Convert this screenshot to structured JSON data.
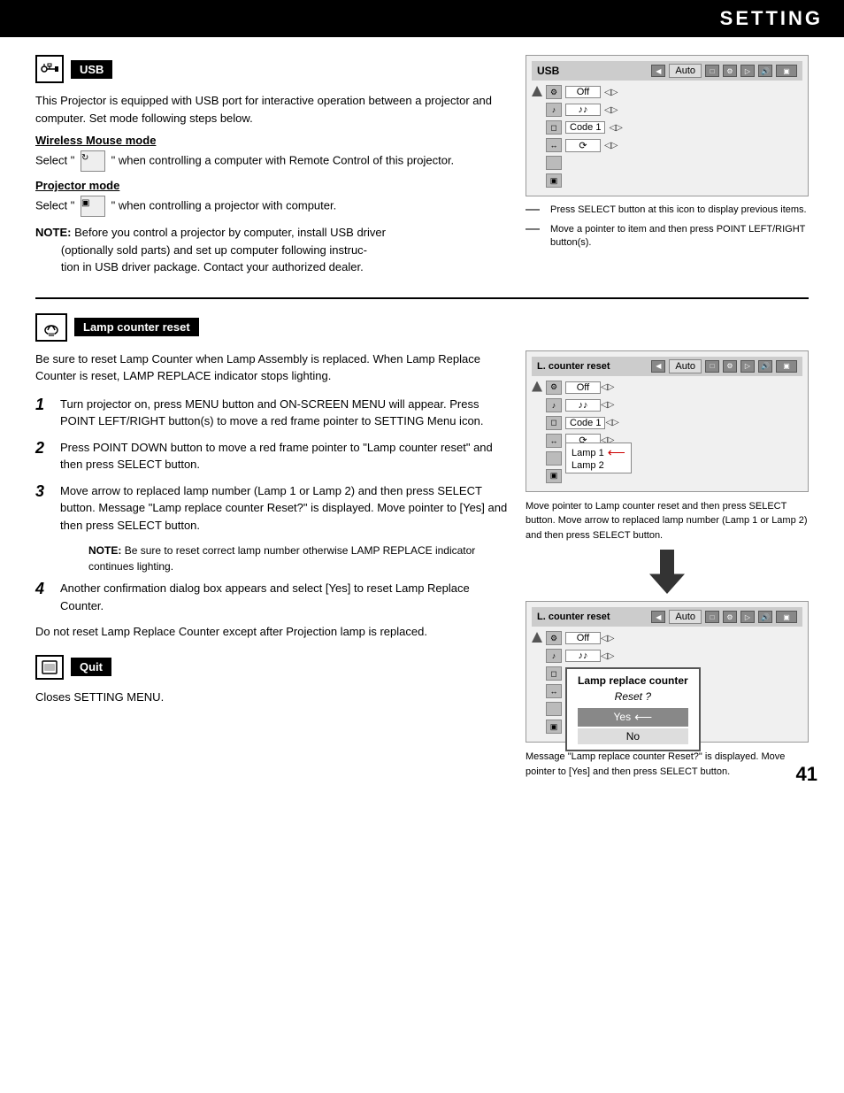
{
  "header": {
    "title": "SETTING"
  },
  "usb": {
    "icon_label": "USB",
    "intro": "This Projector is equipped with USB port for interactive operation between a projector and computer. Set mode following steps below.",
    "wireless_title": "Wireless Mouse mode",
    "wireless_text": "Select \"      \" when controlling a computer with Remote Control of this projector.",
    "projector_title": "Projector mode",
    "projector_text": "Select \"      \" when controlling a projector with computer.",
    "note_label": "NOTE:",
    "note_text": "Before you control a projector by computer, install USB driver (optionally sold parts) and set up computer following instruc-tion in USB driver package. Contact your authorized dealer.",
    "diagram": {
      "label": "USB",
      "auto": "Auto",
      "rows": [
        {
          "icon": "▲",
          "value": "Off",
          "arrow": "◁▷"
        },
        {
          "icon": "⚙",
          "value": "♪♪",
          "arrow": "◁▷"
        },
        {
          "icon": "◻",
          "value": "Code 1",
          "arrow": "◁▷"
        },
        {
          "icon": "↔",
          "value": "⟳",
          "arrow": "◁▷"
        },
        {
          "icon": "⬜",
          "value": "",
          "arrow": ""
        },
        {
          "icon": "▣",
          "value": "",
          "arrow": ""
        }
      ]
    },
    "callout1": "Press SELECT button at this icon to display previous items.",
    "callout2": "Move a pointer to item and then press POINT LEFT/RIGHT button(s)."
  },
  "lamp": {
    "icon_label": "Lamp counter reset",
    "intro": "Be sure to reset Lamp Counter when Lamp Assembly is replaced.  When Lamp Replace Counter is reset, LAMP REPLACE indicator stops lighting.",
    "steps": [
      {
        "num": "1",
        "text": "Turn projector on, press MENU button and ON-SCREEN MENU will appear.  Press POINT LEFT/RIGHT button(s) to move a red frame pointer to SETTING Menu icon."
      },
      {
        "num": "2",
        "text": "Press POINT DOWN button to move a red frame pointer to \"Lamp counter reset\" and then press SELECT button."
      },
      {
        "num": "3",
        "text": "Move arrow to replaced lamp number (Lamp 1 or Lamp 2) and then press SELECT button.  Message \"Lamp replace counter Reset?\" is displayed. Move pointer to [Yes] and then press SELECT button."
      },
      {
        "num": "4",
        "text": "Another confirmation dialog box appears and select [Yes] to reset Lamp Replace Counter."
      }
    ],
    "note3_label": "NOTE:",
    "note3_text": "Be sure to reset correct lamp number otherwise LAMP REPLACE indicator continues lighting.",
    "footer_text": "Do not reset Lamp Replace Counter except after Projection lamp is replaced.",
    "diagram1": {
      "label": "L. counter reset",
      "auto": "Auto",
      "rows": [
        {
          "value": "Off",
          "arrow": "◁▷"
        },
        {
          "value": "♪♪",
          "arrow": "◁▷"
        },
        {
          "value": "Code 1",
          "arrow": "◁▷"
        },
        {
          "value": "⟳",
          "arrow": "◁▷"
        },
        {
          "value": "",
          "arrow": ""
        },
        {
          "value": "",
          "arrow": ""
        }
      ],
      "lamp_options": [
        "Lamp 1",
        "Lamp 2"
      ],
      "note": "Move pointer to Lamp counter reset and then press SELECT button.  Move arrow to replaced lamp number (Lamp 1 or Lamp 2) and then press SELECT button."
    },
    "diagram2": {
      "label": "L. counter reset",
      "auto": "Auto",
      "dialog": {
        "title": "Lamp replace counter",
        "subtitle": "Reset ?",
        "yes": "Yes",
        "no": "No"
      },
      "note": "Message \"Lamp replace counter Reset?\" is displayed. Move pointer to [Yes] and then press SELECT button."
    }
  },
  "quit": {
    "label": "Quit",
    "description": "Closes SETTING MENU."
  },
  "page_number": "41"
}
